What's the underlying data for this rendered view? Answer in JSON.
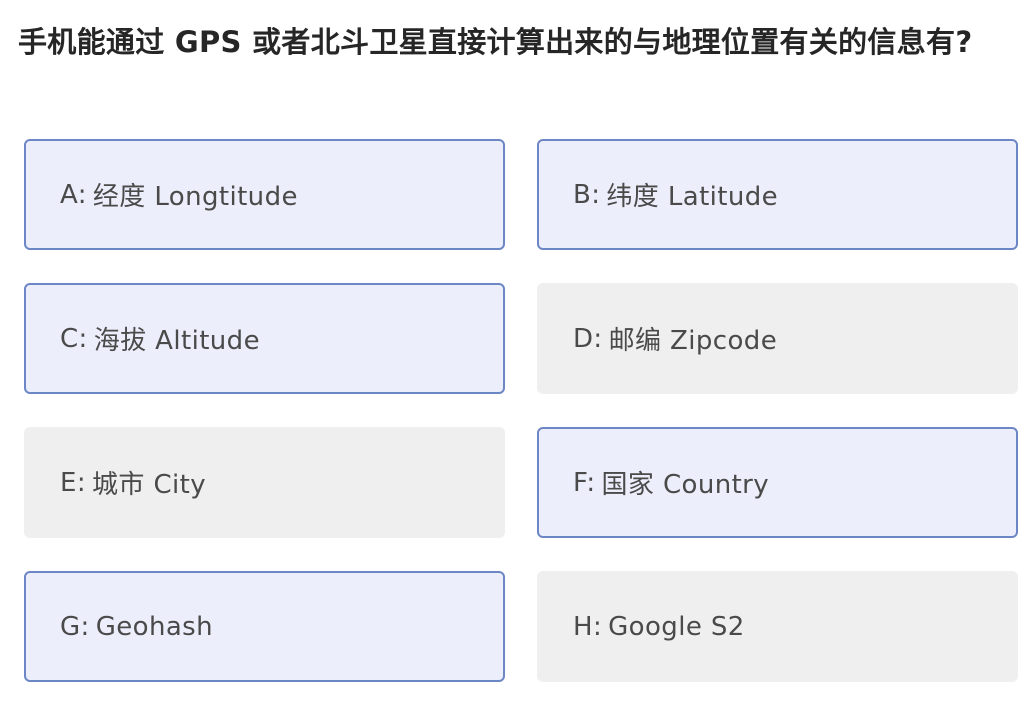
{
  "question": {
    "text": "手机能通过 GPS 或者北斗卫星直接计算出来的与地理位置有关的信息有?"
  },
  "colors": {
    "selected_bg": "#eceffb",
    "selected_border": "#6c86c6",
    "unselected_bg": "#efefef"
  },
  "options": [
    {
      "letter": "A:",
      "label": "经度 Longtitude",
      "selected": true
    },
    {
      "letter": "B:",
      "label": "纬度 Latitude",
      "selected": true
    },
    {
      "letter": "C:",
      "label": "海拔 Altitude",
      "selected": true
    },
    {
      "letter": "D:",
      "label": "邮编 Zipcode",
      "selected": false
    },
    {
      "letter": "E:",
      "label": "城市 City",
      "selected": false
    },
    {
      "letter": "F:",
      "label": "国家 Country",
      "selected": true
    },
    {
      "letter": "G:",
      "label": "Geohash",
      "selected": true
    },
    {
      "letter": "H:",
      "label": "Google S2",
      "selected": false
    }
  ]
}
